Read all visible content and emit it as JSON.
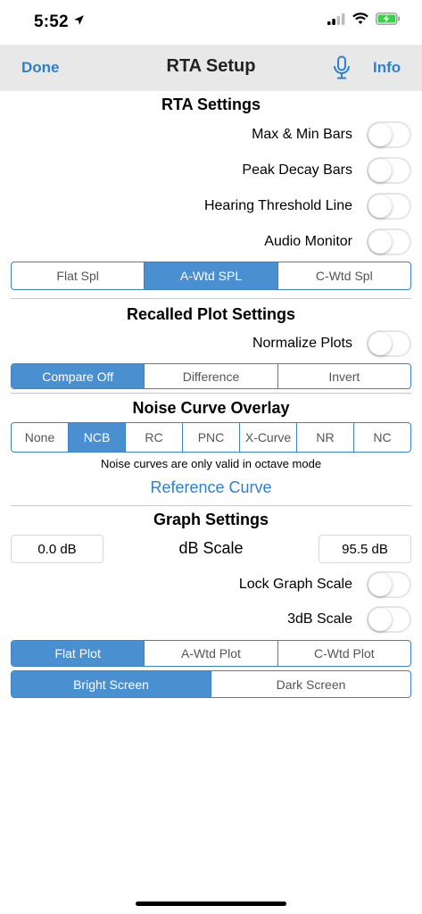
{
  "status": {
    "time": "5:52"
  },
  "nav": {
    "done": "Done",
    "title": "RTA Setup",
    "info": "Info"
  },
  "rta": {
    "title": "RTA Settings",
    "toggles": [
      {
        "label": "Max & Min Bars",
        "on": false
      },
      {
        "label": "Peak Decay Bars",
        "on": false
      },
      {
        "label": "Hearing Threshold Line",
        "on": false
      },
      {
        "label": "Audio Monitor",
        "on": false
      }
    ],
    "weighting": {
      "options": [
        "Flat Spl",
        "A-Wtd SPL",
        "C-Wtd Spl"
      ],
      "selected": 1
    }
  },
  "recalled": {
    "title": "Recalled Plot Settings",
    "normalize": {
      "label": "Normalize Plots",
      "on": false
    },
    "compare": {
      "options": [
        "Compare Off",
        "Difference",
        "Invert"
      ],
      "selected": 0
    }
  },
  "noise": {
    "title": "Noise Curve Overlay",
    "options": [
      "None",
      "NCB",
      "RC",
      "PNC",
      "X-Curve",
      "NR",
      "NC"
    ],
    "selected": 1,
    "note": "Noise curves are only valid in octave mode",
    "reference": "Reference Curve"
  },
  "graph": {
    "title": "Graph Settings",
    "min_db": "0.0 dB",
    "scale_label": "dB Scale",
    "max_db": "95.5 dB",
    "lock": {
      "label": "Lock Graph Scale",
      "on": false
    },
    "three_db": {
      "label": "3dB Scale",
      "on": false
    },
    "plot": {
      "options": [
        "Flat Plot",
        "A-Wtd Plot",
        "C-Wtd Plot"
      ],
      "selected": 0
    },
    "screen": {
      "options": [
        "Bright Screen",
        "Dark Screen"
      ],
      "selected": 0
    }
  },
  "colors": {
    "accent": "#2f7fcf",
    "segment_selected": "#4a90d0",
    "nav_bg": "#e8e8e8",
    "battery": "#3ccf4e"
  }
}
